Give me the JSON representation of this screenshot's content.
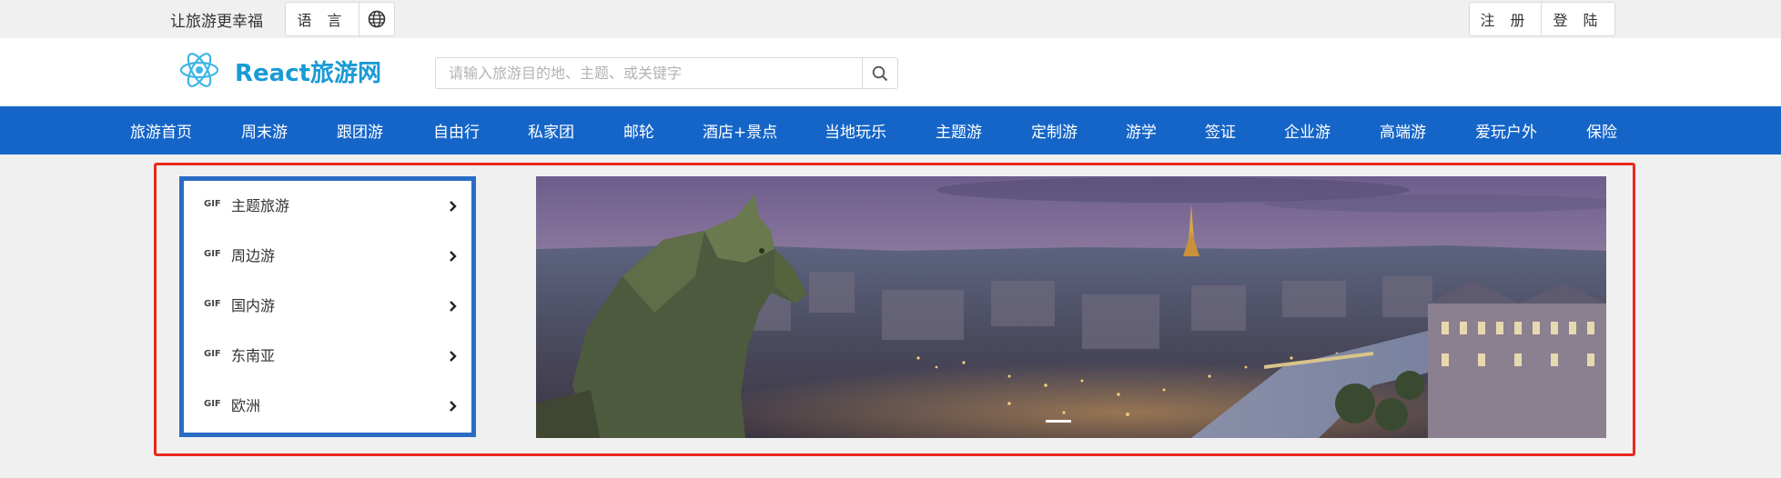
{
  "topbar": {
    "slogan": "让旅游更幸福",
    "language_label": "语 言",
    "register_label": "注 册",
    "login_label": "登 陆"
  },
  "header": {
    "brand": "React旅游网",
    "search_placeholder": "请输入旅游目的地、主题、或关键字"
  },
  "nav": {
    "items": [
      {
        "label": "旅游首页"
      },
      {
        "label": "周末游"
      },
      {
        "label": "跟团游"
      },
      {
        "label": "自由行"
      },
      {
        "label": "私家团"
      },
      {
        "label": "邮轮"
      },
      {
        "label": "酒店+景点"
      },
      {
        "label": "当地玩乐"
      },
      {
        "label": "主题游"
      },
      {
        "label": "定制游"
      },
      {
        "label": "游学"
      },
      {
        "label": "签证"
      },
      {
        "label": "企业游"
      },
      {
        "label": "高端游"
      },
      {
        "label": "爱玩户外"
      },
      {
        "label": "保险"
      }
    ]
  },
  "side_menu": {
    "items": [
      {
        "badge": "GIF",
        "label": "主题旅游",
        "icon": "chevron-right-icon"
      },
      {
        "badge": "GIF",
        "label": "周边游",
        "icon": "chevron-right-icon"
      },
      {
        "badge": "GIF",
        "label": "国内游",
        "icon": "chevron-right-icon"
      },
      {
        "badge": "GIF",
        "label": "东南亚",
        "icon": "chevron-right-icon"
      },
      {
        "badge": "GIF",
        "label": "欧洲",
        "icon": "chevron-right-icon"
      }
    ]
  },
  "colors": {
    "nav_bg": "#1565c8",
    "brand": "#1a9ad6",
    "menu_border": "#2a6cc4",
    "highlight_frame": "#e8291c"
  },
  "icons": {
    "globe": "globe-icon",
    "search": "search-icon",
    "logo": "react-logo-icon"
  }
}
